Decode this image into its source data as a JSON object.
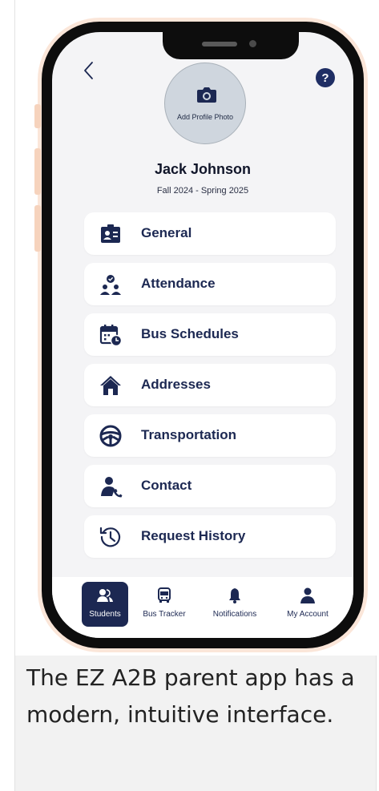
{
  "screen": {
    "profile_photo_label": "Add Profile Photo",
    "student_name": "Jack Johnson",
    "term": "Fall 2024 - Spring 2025"
  },
  "menu": [
    {
      "label": "General",
      "icon": "id-card-icon"
    },
    {
      "label": "Attendance",
      "icon": "attendance-group-icon"
    },
    {
      "label": "Bus Schedules",
      "icon": "calendar-clock-icon"
    },
    {
      "label": "Addresses",
      "icon": "house-icon"
    },
    {
      "label": "Transportation",
      "icon": "steering-wheel-icon"
    },
    {
      "label": "Contact",
      "icon": "contact-phone-icon"
    },
    {
      "label": "Request History",
      "icon": "history-icon"
    }
  ],
  "tabbar": [
    {
      "label": "Students",
      "icon": "students-icon",
      "active": true
    },
    {
      "label": "Bus Tracker",
      "icon": "bus-icon",
      "active": false
    },
    {
      "label": "Notifications",
      "icon": "bell-icon",
      "active": false
    },
    {
      "label": "My Account",
      "icon": "person-icon",
      "active": false
    }
  ],
  "caption": "The EZ A2B parent app has a modern, intuitive interface.",
  "colors": {
    "navy": "#1c2852",
    "phone_frame": "#fbe6d9",
    "screen_bg": "#f4f4f6"
  }
}
